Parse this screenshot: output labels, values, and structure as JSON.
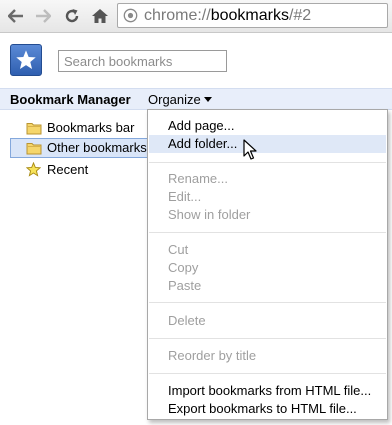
{
  "toolbar": {
    "icons": [
      "back-arrow-icon",
      "forward-arrow-icon",
      "reload-icon",
      "home-icon"
    ],
    "url": {
      "scheme": "chrome://",
      "host": "bookmarks",
      "hash": "/#2"
    }
  },
  "header": {
    "logo_icon": "star-icon",
    "search_placeholder": "Search bookmarks",
    "search_value": ""
  },
  "titlebar": {
    "title": "Bookmark Manager",
    "organize_label": "Organize"
  },
  "tree": {
    "items": [
      {
        "label": "Bookmarks bar",
        "icon": "folder-icon",
        "selected": false
      },
      {
        "label": "Other bookmarks",
        "icon": "folder-icon",
        "selected": true
      },
      {
        "label": "Recent",
        "icon": "star-icon",
        "selected": false
      }
    ]
  },
  "menu": {
    "items": [
      {
        "label": "Add page...",
        "enabled": true
      },
      {
        "label": "Add folder...",
        "enabled": true,
        "hover": true
      },
      {
        "label": "Rename...",
        "enabled": false
      },
      {
        "label": "Edit...",
        "enabled": false
      },
      {
        "label": "Show in folder",
        "enabled": false
      },
      {
        "label": "Cut",
        "enabled": false
      },
      {
        "label": "Copy",
        "enabled": false
      },
      {
        "label": "Paste",
        "enabled": false
      },
      {
        "label": "Delete",
        "enabled": false
      },
      {
        "label": "Reorder by title",
        "enabled": false
      },
      {
        "label": "Import bookmarks from HTML file...",
        "enabled": true
      },
      {
        "label": "Export bookmarks to HTML file...",
        "enabled": true
      }
    ]
  },
  "colors": {
    "titlebar_bg": "#e8eefa",
    "selected_bg": "#d9e5f8",
    "selected_border": "#84a8dc",
    "menu_hover": "#dfe8f7",
    "disabled_text": "#9f9f9f",
    "logo_blue": "#2f5fb0"
  }
}
